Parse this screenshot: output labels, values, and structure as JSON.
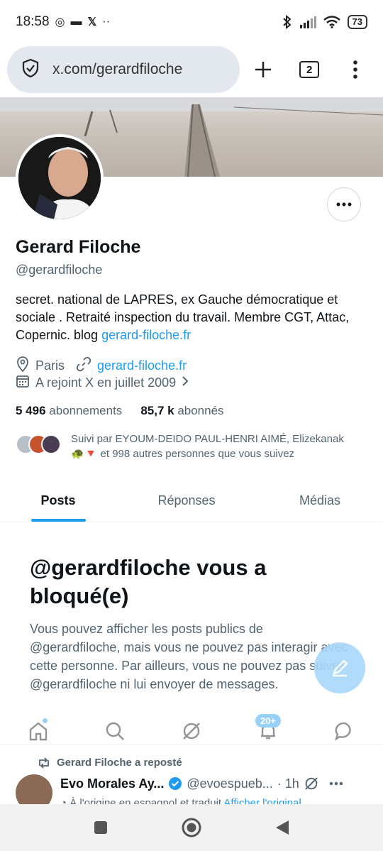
{
  "status_bar": {
    "time": "18:58",
    "battery": "73"
  },
  "browser": {
    "url": "x.com/gerardfiloche",
    "tab_count": "2"
  },
  "profile": {
    "name": "Gerard Filoche",
    "handle": "@gerardfiloche",
    "bio_text": "secret. national de LAPRES, ex Gauche démocratique et sociale . Retraité inspection du travail. Membre CGT, Attac, Copernic. blog ",
    "bio_link": "gerard-filoche.fr",
    "location": "Paris",
    "website": "gerard-filoche.fr",
    "joined": "A rejoint X en juillet 2009",
    "following_count": "5 496",
    "following_label": "abonnements",
    "followers_count": "85,7 k",
    "followers_label": "abonnés",
    "followed_by_line1": "Suivi par EYOUM-DEIDO PAUL-HENRI AIMÉ, Elizekanak",
    "followed_by_emoji": "🐢🔻",
    "followed_by_line2": " et 998 autres personnes que vous suivez"
  },
  "tabs": [
    {
      "label": "Posts",
      "active": true
    },
    {
      "label": "Réponses"
    },
    {
      "label": "Médias"
    }
  ],
  "blocked": {
    "title": "@gerardfiloche vous a bloqué(e)",
    "text": "Vous pouvez afficher les posts publics de @gerardfiloche, mais vous ne pouvez pas interagir avec cette personne. Par ailleurs, vous ne pouvez pas suivre @gerardfiloche ni lui envoyer de messages."
  },
  "bottom_nav": {
    "notifications_badge": "20+"
  },
  "timeline": {
    "repost_label": "Gerard Filoche a reposté",
    "author_name": "Evo Morales Ay...",
    "author_handle": "@evoespueb...",
    "time": "· 1h",
    "original_note": "À l'origine en espagnol et traduit",
    "show_original": "Afficher l'original"
  },
  "colors": {
    "accent": "#1d9bf0",
    "secondary_text": "#536471"
  }
}
